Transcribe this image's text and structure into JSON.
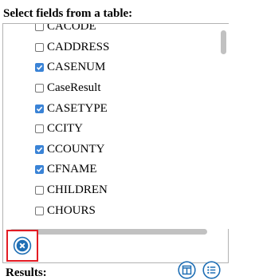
{
  "heading": "Select fields from a table:",
  "fields": [
    {
      "label": "CACODE",
      "checked": false
    },
    {
      "label": "CADDRESS",
      "checked": false
    },
    {
      "label": "CASENUM",
      "checked": true
    },
    {
      "label": "CaseResult",
      "checked": false
    },
    {
      "label": "CASETYPE",
      "checked": true
    },
    {
      "label": "CCITY",
      "checked": false
    },
    {
      "label": "CCOUNTY",
      "checked": true
    },
    {
      "label": "CFNAME",
      "checked": true
    },
    {
      "label": "CHILDREN",
      "checked": false
    },
    {
      "label": "CHOURS",
      "checked": false
    }
  ],
  "toolbar": {
    "clear_icon": "close-circle-icon",
    "table_icon": "table-view-icon",
    "list_icon": "list-view-icon"
  },
  "results_label": "Results:",
  "colors": {
    "accent": "#1f6fb5",
    "checkbox_checked": "#3a83d6",
    "highlight_border": "#e31b23"
  }
}
